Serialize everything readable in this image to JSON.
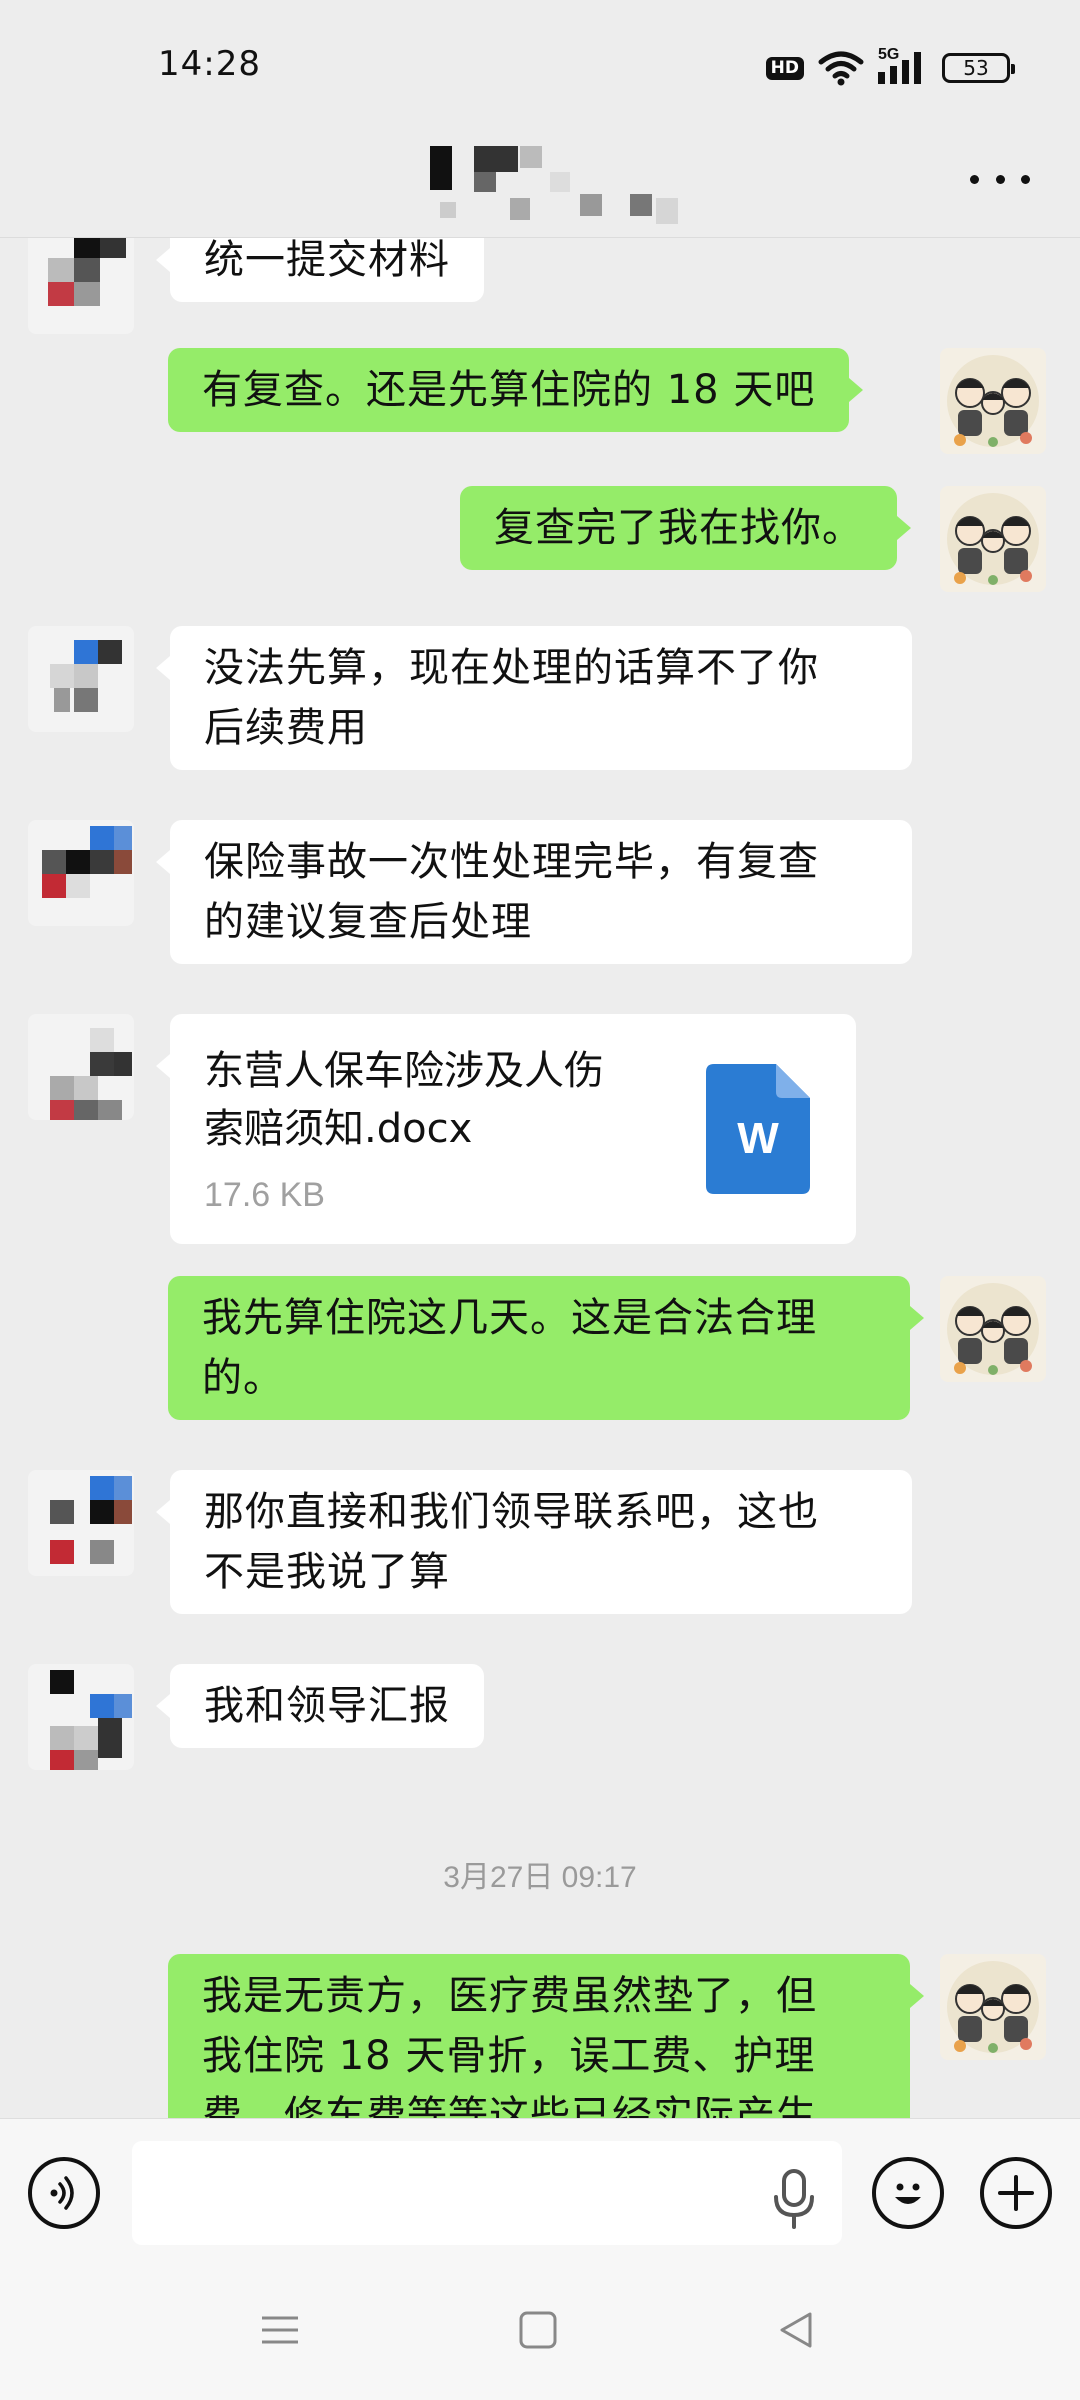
{
  "status_bar": {
    "time": "14:28",
    "hd_label": "HD",
    "network_label": "5G",
    "battery_level": "53"
  },
  "header": {
    "more_icon": "more-dots-icon"
  },
  "messages": [
    {
      "side": "in",
      "text": "统一提交材料"
    },
    {
      "side": "out",
      "text": "有复查。还是先算住院的 18 天吧"
    },
    {
      "side": "out",
      "text": "复查完了我在找你。"
    },
    {
      "side": "in",
      "text_line1": "没法先算，现在处理的话算不了你",
      "text_line2": "后续费用"
    },
    {
      "side": "in",
      "text_line1": "保险事故一次性处理完毕，有复查",
      "text_line2": "的建议复查后处理"
    },
    {
      "side": "in",
      "type": "file",
      "file_name_line1": "东营人保车险涉及人伤",
      "file_name_line2": "索赔须知.docx",
      "file_size": "17.6 KB",
      "file_icon_letter": "W"
    },
    {
      "side": "out",
      "text_line1": "我先算住院这几天。这是合法合理",
      "text_line2": "的。"
    },
    {
      "side": "in",
      "text_line1": "那你直接和我们领导联系吧，这也",
      "text_line2": "不是我说了算"
    },
    {
      "side": "in",
      "text": "我和领导汇报"
    },
    {
      "side": "out",
      "text_line1": "我是无责方，医疗费虽然垫了，但",
      "text_line2": "我住院 18 天骨折，误工费、护理",
      "text_line3": "费、修车费等等这些已经实际产生"
    }
  ],
  "timestamp": "3月27日 09:17",
  "input_bar": {
    "voice_icon": "voice-icon",
    "mic_icon": "microphone-icon",
    "emoji_icon": "emoji-icon",
    "plus_icon": "plus-icon",
    "message_value": ""
  },
  "nav_bar": {
    "menu_icon": "menu-icon",
    "home_icon": "home-icon",
    "back_icon": "back-icon"
  },
  "colors": {
    "background": "#ededed",
    "outgoing_bubble": "#95ec69",
    "incoming_bubble": "#ffffff",
    "word_icon": "#2b7cd3"
  }
}
